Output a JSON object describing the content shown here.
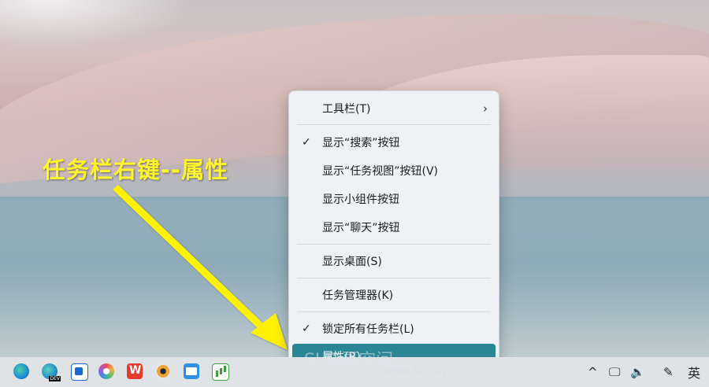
{
  "annotation": {
    "text": "任务栏右键--属性"
  },
  "context_menu": {
    "items": [
      {
        "label": "工具栏(T)",
        "checked": false,
        "submenu": true
      },
      {
        "label": "显示“搜索”按钮",
        "checked": true,
        "submenu": false
      },
      {
        "label": "显示“任务视图”按钮(V)",
        "checked": false,
        "submenu": false
      },
      {
        "label": "显示小组件按钮",
        "checked": false,
        "submenu": false
      },
      {
        "label": "显示“聊天”按钮",
        "checked": false,
        "submenu": false
      },
      {
        "label": "显示桌面(S)",
        "checked": false,
        "submenu": false
      },
      {
        "label": "任务管理器(K)",
        "checked": false,
        "submenu": false
      },
      {
        "label": "锁定所有任务栏(L)",
        "checked": true,
        "submenu": false
      },
      {
        "label": "属性(R)",
        "checked": false,
        "submenu": false,
        "highlighted": true
      }
    ],
    "check_glyph": "✓",
    "chevron_glyph": "›",
    "highlight_color": "#2a8595"
  },
  "watermark": {
    "text": "SUG哥空间",
    "url": "www.sug.xyz"
  },
  "taskbar": {
    "apps": [
      {
        "icon": "edge-icon"
      },
      {
        "icon": "edge-dev-icon"
      },
      {
        "icon": "app-icon"
      },
      {
        "icon": "color-wheel-icon"
      },
      {
        "icon": "wps-icon"
      },
      {
        "icon": "eye-icon"
      },
      {
        "icon": "file-explorer-icon"
      },
      {
        "icon": "notepad-chart-icon"
      }
    ],
    "tray": {
      "chevron": "^",
      "network_glyph": "🖵",
      "volume_glyph": "🔈",
      "pen_glyph": "✎",
      "language": "英"
    }
  },
  "colors": {
    "annotation": "#fff52b",
    "arrow": "#fff200"
  }
}
